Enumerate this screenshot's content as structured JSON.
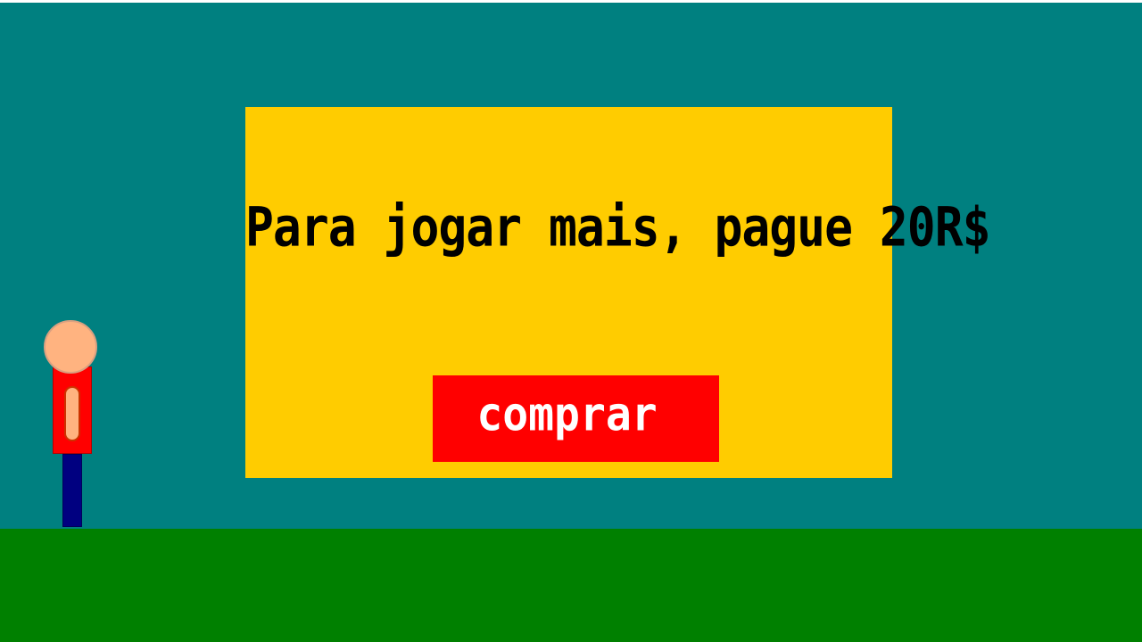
{
  "colors": {
    "sky": "#008080",
    "ground": "#008000",
    "paywall_panel": "#ffcc00",
    "buy_button": "#ff0000",
    "player_skin": "#ffb380",
    "player_shirt": "#ff0000",
    "player_pants": "#000080"
  },
  "paywall": {
    "message": "Para jogar mais, pague 20R$",
    "buy_label": "comprar"
  }
}
